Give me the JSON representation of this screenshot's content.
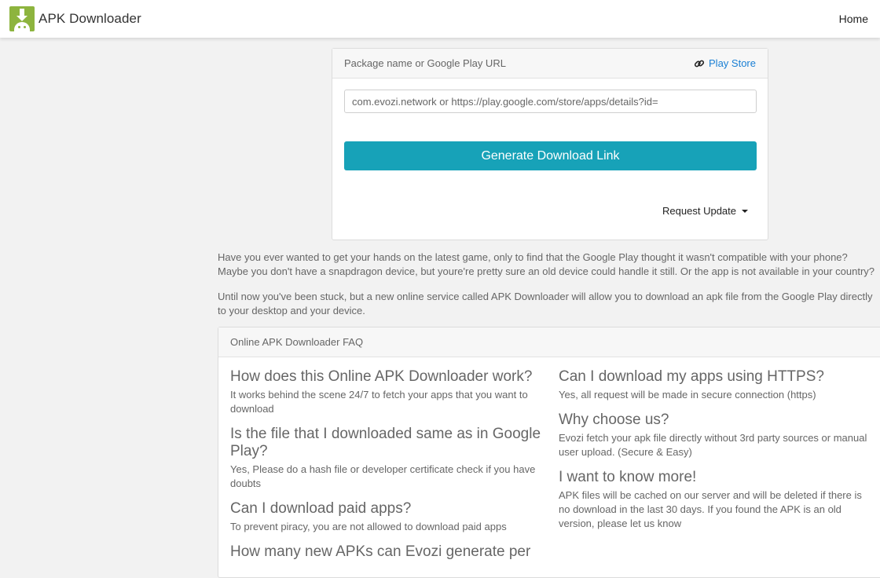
{
  "navbar": {
    "brand_name": "APK Downloader",
    "home_label": "Home",
    "logo_icon": "android-download-icon"
  },
  "form": {
    "header_label": "Package name or Google Play URL",
    "play_store_label": "Play Store",
    "input_placeholder": "com.evozi.network or https://play.google.com/store/apps/details?id=",
    "input_value": "",
    "generate_label": "Generate Download Link",
    "request_update_label": "Request Update"
  },
  "intro": {
    "line1": "Have you ever wanted to get your hands on the latest game, only to find that the Google Play thought it wasn't compatible with your phone?",
    "line2": "Maybe you don't have a snapdragon device, but youre're pretty sure an old device could handle it still. Or the app is not available in your country?",
    "line3": "Until now you've been stuck, but a new online service called APK Downloader will allow you to download an apk file from the Google Play directly to your desktop and your device."
  },
  "faq": {
    "title": "Online APK Downloader FAQ",
    "left": [
      {
        "q": "How does this Online APK Downloader work?",
        "a": "It works behind the scene 24/7 to fetch your apps that you want to download"
      },
      {
        "q": "Is the file that I downloaded same as in Google Play?",
        "a": "Yes, Please do a hash file or developer certificate check if you have doubts"
      },
      {
        "q": "Can I download paid apps?",
        "a": "To prevent piracy, you are not allowed to download paid apps"
      },
      {
        "q": "How many new APKs can Evozi generate per",
        "a": ""
      }
    ],
    "right": [
      {
        "q": "Can I download my apps using HTTPS?",
        "a": "Yes, all request will be made in secure connection (https)"
      },
      {
        "q": "Why choose us?",
        "a": "Evozi fetch your apk file directly without 3rd party sources or manual user upload. (Secure & Easy)"
      },
      {
        "q": "I want to know more!",
        "a": "APK files will be cached on our server and will be deleted if there is no download in the last 30 days. If you found the APK is an old version, please let us know"
      }
    ]
  },
  "colors": {
    "accent": "#17a2b8",
    "link": "#1a7fd4",
    "logo": "#8db43e"
  }
}
